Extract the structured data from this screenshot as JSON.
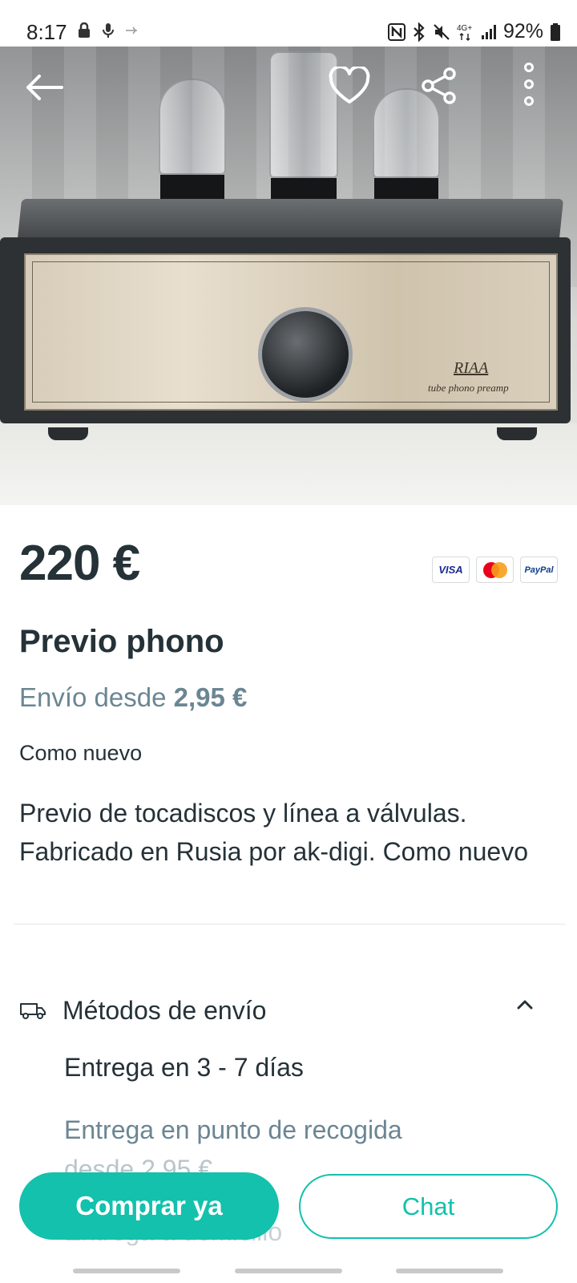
{
  "status_bar": {
    "time": "8:17",
    "battery": "92%",
    "left_icons": [
      "lock-icon",
      "mic-icon",
      "usb-icon"
    ],
    "right_icons": [
      "nfc-icon",
      "bluetooth-icon",
      "mute-icon",
      "4g-signal-icon",
      "signal-bars-icon",
      "battery-icon"
    ]
  },
  "hero": {
    "image_label": "RIAA",
    "image_sublabel": "tube phono preamp",
    "current_slide": 1,
    "total_slides": 1
  },
  "product": {
    "price": "220 €",
    "title": "Previo phono",
    "shipping_prefix": "Envío desde",
    "shipping_price": "2,95 €",
    "condition": "Como nuevo",
    "description": "Previo de tocadiscos y línea a válvulas. Fabricado en Rusia por ak-digi. Como nuevo"
  },
  "payment_methods": [
    "VISA",
    "Mastercard",
    "PayPal"
  ],
  "shipping_methods": {
    "label": "Métodos de envío",
    "expanded": true,
    "delivery_time": "Entrega en 3 - 7 días",
    "pickup_point": "Entrega en punto de recogida",
    "pickup_point_price": "desde 2,95 €",
    "home_delivery": "Entrega a domicilio"
  },
  "actions": {
    "buy_label": "Comprar ya",
    "chat_label": "Chat"
  },
  "colors": {
    "accent": "#13c1ac",
    "text_primary": "#253238",
    "text_secondary": "#6b8693"
  }
}
